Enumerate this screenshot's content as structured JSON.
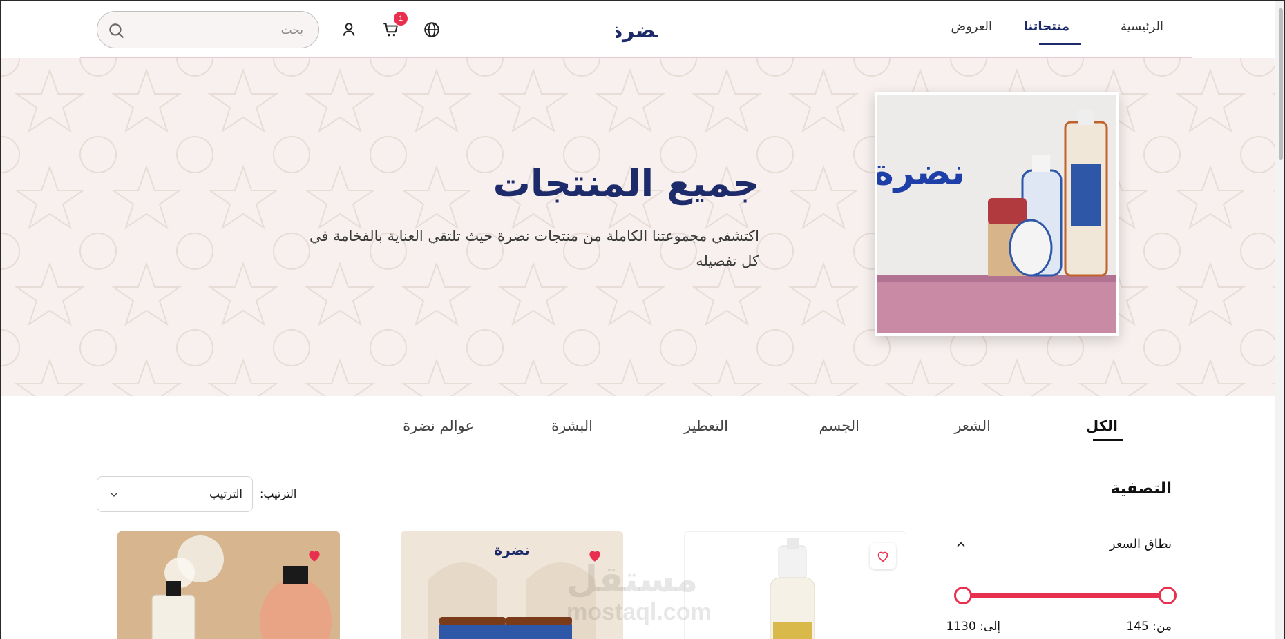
{
  "header": {
    "nav": [
      "الرئيسية",
      "منتجاتنا",
      "العروض"
    ],
    "active_nav": "منتجاتنا",
    "logo_text": "نضرة",
    "cart_count": "1",
    "search_placeholder": "بحث"
  },
  "hero": {
    "title": "جميع المنتجات",
    "subtitle": "اكتشفي مجموعتنا الكاملة من منتجات نضرة حيث تلتقي العناية بالفخامة في كل تفصيله",
    "image_logo_text": "نضرة"
  },
  "tabs": [
    "الكل",
    "الشعر",
    "الجسم",
    "التعطير",
    "البشرة",
    "عوالم نضرة"
  ],
  "active_tab": "الكل",
  "filter": {
    "title": "التصفية",
    "price_range_label": "نطاق السعر",
    "from_label": "من: 145",
    "to_label": "إلى: 1130"
  },
  "sort": {
    "label": "الترتيب:",
    "selected": "الترتيب"
  },
  "products": [
    {
      "favorited": false,
      "icon": "heart-outline-icon"
    },
    {
      "favorited": true,
      "icon": "heart-filled-icon",
      "brand_text": "نضرة"
    },
    {
      "favorited": true,
      "icon": "heart-filled-icon"
    }
  ],
  "watermark": {
    "text": "مستقل",
    "url_text": "mostaql.com"
  },
  "colors": {
    "brand_navy": "#1d2b6a",
    "accent_red": "#e8304e",
    "hero_bg": "#f7f0ee"
  }
}
